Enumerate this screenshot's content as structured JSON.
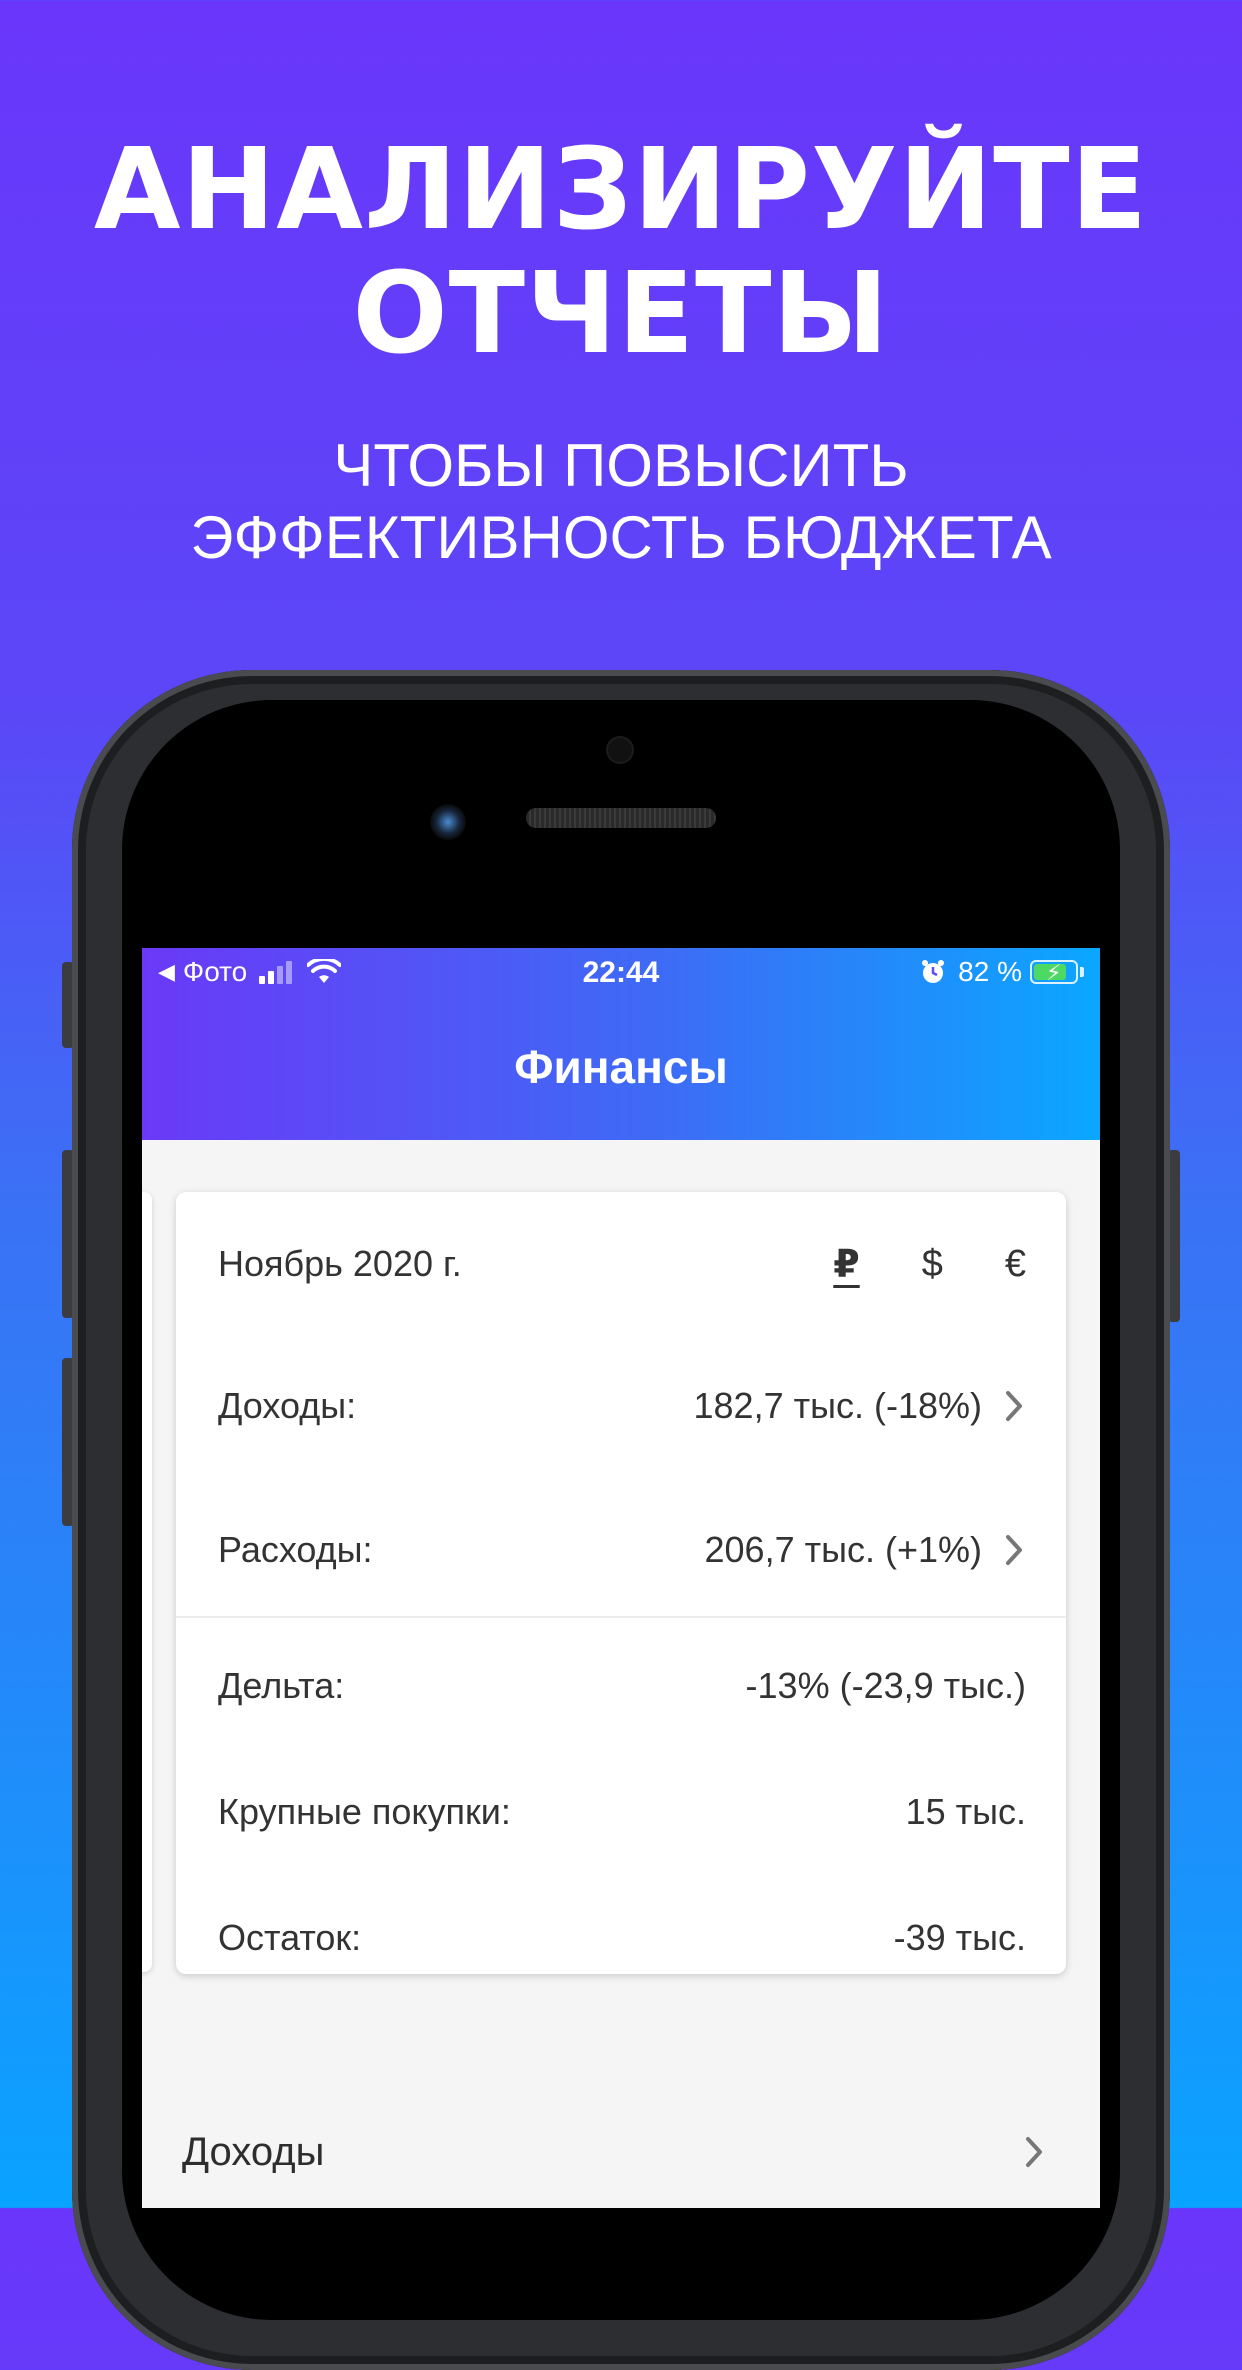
{
  "promo": {
    "headline_line1": "АНАЛИЗИРУЙТЕ",
    "headline_line2": "ОТЧЕТЫ",
    "subheadline_line1": "ЧТОБЫ ПОВЫСИТЬ",
    "subheadline_line2": "ЭФФЕКТИВНОСТЬ БЮДЖЕТА"
  },
  "status_bar": {
    "back_app": "Фото",
    "time": "22:44",
    "battery_percent": "82 %",
    "battery_level": 0.82
  },
  "app": {
    "title": "Финансы"
  },
  "report_card": {
    "period": "Ноябрь 2020 г.",
    "currencies": [
      "₽",
      "$",
      "€"
    ],
    "selected_currency": "₽",
    "rows": [
      {
        "label": "Доходы:",
        "value": "182,7 тыс. (-18%)"
      },
      {
        "label": "Расходы:",
        "value": "206,7 тыс. (+1%)"
      },
      {
        "label": "Дельта:",
        "value": "-13% (-23,9 тыс.)"
      },
      {
        "label": "Крупные покупки:",
        "value": "15 тыс."
      },
      {
        "label": "Остаток:",
        "value": "-39 тыс."
      }
    ]
  },
  "sections": [
    {
      "label": "Доходы"
    }
  ],
  "colors": {
    "gradient_top": "#6a36fb",
    "gradient_bottom": "#0aa3ff",
    "battery_green": "#4cd964"
  }
}
